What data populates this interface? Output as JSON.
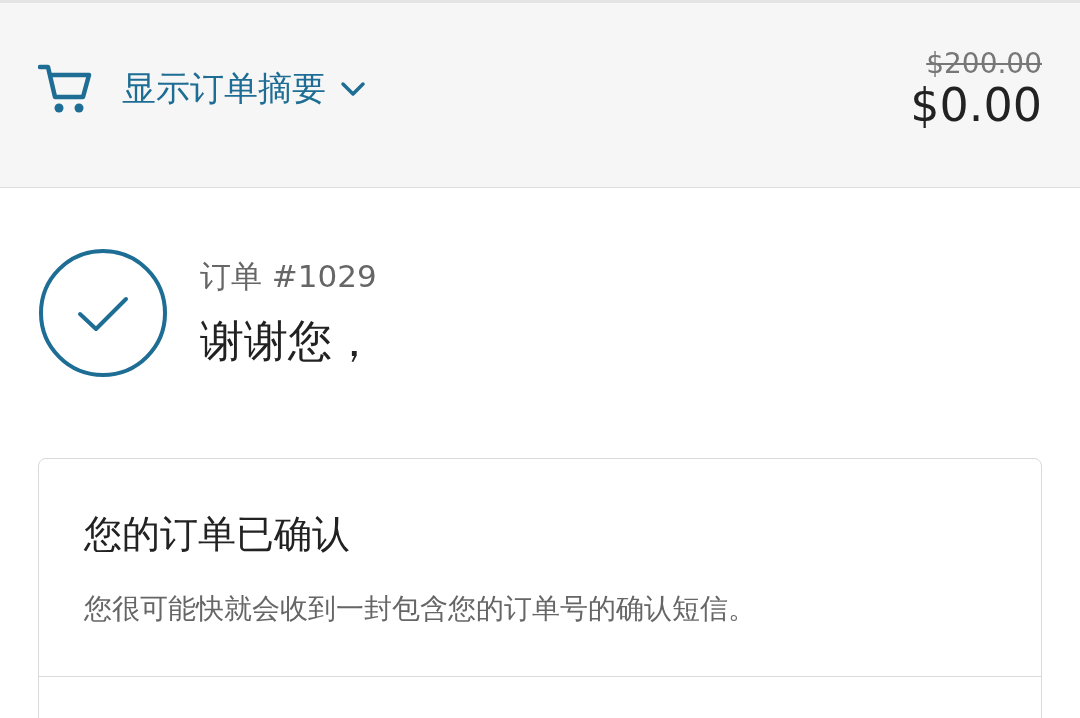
{
  "summary_bar": {
    "toggle_label": "显示订单摘要",
    "expanded": false,
    "original_price": "$200.00",
    "total": "$0.00"
  },
  "order": {
    "number": "订单 #1029",
    "greeting": "谢谢您，",
    "confirmed": true
  },
  "confirmation_card": {
    "title": "您的订单已确认",
    "message": "您很可能快就会收到一封包含您的订单号的确认短信。"
  }
}
